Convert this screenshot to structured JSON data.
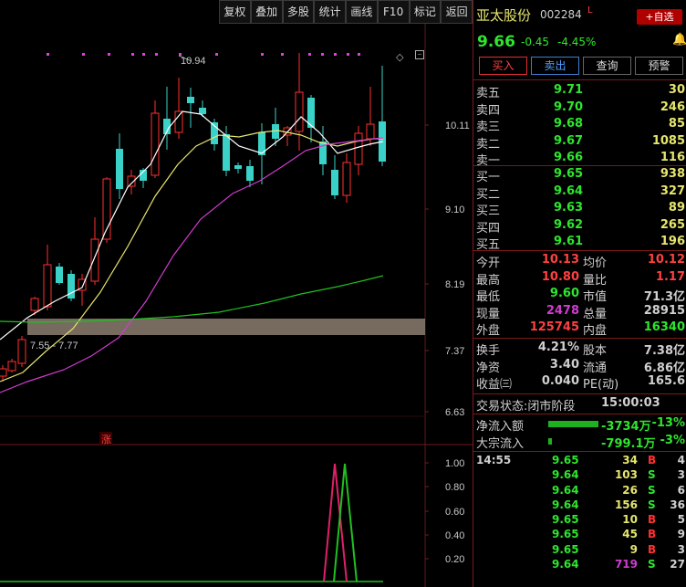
{
  "toolbar": {
    "items": [
      "复权",
      "叠加",
      "多股",
      "统计",
      "画线",
      "F10",
      "标记",
      "返回"
    ]
  },
  "chart": {
    "price_labels": [
      "10.11",
      "9.10",
      "8.19",
      "7.37",
      "6.63"
    ],
    "sub_labels": [
      "1.00",
      "0.80",
      "0.60",
      "0.40",
      "0.20"
    ],
    "high_annotation": "10.94",
    "range_annotation": "7.55 - 7.77",
    "zhang_label": "涨"
  },
  "stock": {
    "name": "亚太股份",
    "code": "002284",
    "flag": "L",
    "add_label": "+自选",
    "price": "9.66",
    "change": "-0.45",
    "pct": "-4.45%"
  },
  "actions": {
    "buy": "买入",
    "sell": "卖出",
    "query": "查询",
    "alert": "预警"
  },
  "asks": [
    {
      "label": "卖五",
      "price": "9.71",
      "vol": "30"
    },
    {
      "label": "卖四",
      "price": "9.70",
      "vol": "246"
    },
    {
      "label": "卖三",
      "price": "9.68",
      "vol": "85"
    },
    {
      "label": "卖二",
      "price": "9.67",
      "vol": "1085"
    },
    {
      "label": "卖一",
      "price": "9.66",
      "vol": "116"
    }
  ],
  "bids": [
    {
      "label": "买一",
      "price": "9.65",
      "vol": "938"
    },
    {
      "label": "买二",
      "price": "9.64",
      "vol": "327"
    },
    {
      "label": "买三",
      "price": "9.63",
      "vol": "89"
    },
    {
      "label": "买四",
      "price": "9.62",
      "vol": "265"
    },
    {
      "label": "买五",
      "price": "9.61",
      "vol": "196"
    }
  ],
  "stats": [
    {
      "l1": "今开",
      "v1": "10.13",
      "l2": "均价",
      "v2": "10.12"
    },
    {
      "l1": "最高",
      "v1": "10.80",
      "l2": "量比",
      "v2": "1.17"
    },
    {
      "l1": "最低",
      "v1": "9.60",
      "l2": "市值",
      "v2": "71.3亿"
    },
    {
      "l1": "现量",
      "v1": "2478",
      "l2": "总量",
      "v2": "28915"
    },
    {
      "l1": "外盘",
      "v1": "125745",
      "l2": "内盘",
      "v2": "16340"
    }
  ],
  "stats2": [
    {
      "l1": "换手",
      "v1": "4.21%",
      "l2": "股本",
      "v2": "7.38亿"
    },
    {
      "l1": "净资",
      "v1": "3.40",
      "l2": "流通",
      "v2": "6.86亿"
    },
    {
      "l1": "收益㈢",
      "v1": "0.040",
      "l2": "PE(动)",
      "v2": "165.6"
    }
  ],
  "trade_status": {
    "label": "交易状态:",
    "value": "闭市阶段",
    "time": "15:00:03"
  },
  "flows": [
    {
      "label": "净流入额",
      "bar": 0.98,
      "value": "-3734万",
      "pct": "-13%"
    },
    {
      "label": "大宗流入",
      "bar": 0.08,
      "value": "-799.1万",
      "pct": "-3%"
    }
  ],
  "ticks": [
    {
      "time": "14:55",
      "price": "9.65",
      "vol": "34",
      "side": "B",
      "n": "4"
    },
    {
      "time": "",
      "price": "9.64",
      "vol": "103",
      "side": "S",
      "n": "3"
    },
    {
      "time": "",
      "price": "9.64",
      "vol": "26",
      "side": "S",
      "n": "6"
    },
    {
      "time": "",
      "price": "9.64",
      "vol": "156",
      "side": "S",
      "n": "36"
    },
    {
      "time": "",
      "price": "9.65",
      "vol": "10",
      "side": "B",
      "n": "5"
    },
    {
      "time": "",
      "price": "9.65",
      "vol": "45",
      "side": "B",
      "n": "9"
    },
    {
      "time": "",
      "price": "9.65",
      "vol": "9",
      "side": "B",
      "n": "3"
    },
    {
      "time": "",
      "price": "9.64",
      "vol": "719",
      "side": "S",
      "n": "27"
    }
  ],
  "colors": {
    "up": "#ff3030",
    "down": "#2ee62e",
    "cyan": "#3ad2c8",
    "ma5": "#ffffff",
    "ma10": "#e6e66e",
    "ma20": "#d03cd0",
    "ma60": "#20c020"
  }
}
